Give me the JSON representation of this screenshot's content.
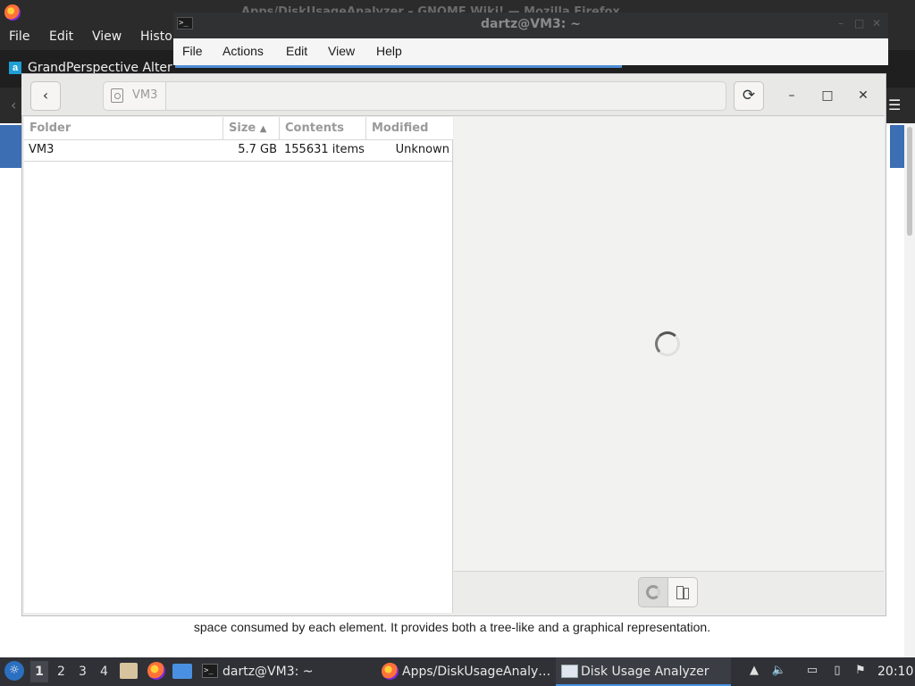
{
  "firefox": {
    "title": "Apps/DiskUsageAnalyzer – GNOME Wiki! — Mozilla Firefox",
    "menu": [
      "File",
      "Edit",
      "View",
      "Histo"
    ],
    "tab_label": "GrandPerspective Altern",
    "tab_icon_letter": "a",
    "page_text": "space consumed by each element. It provides both a tree-like and a graphical representation."
  },
  "terminal": {
    "title": "dartz@VM3: ~",
    "icon_text": ">_",
    "menu": [
      "File",
      "Actions",
      "Edit",
      "View",
      "Help"
    ]
  },
  "dua": {
    "path_label": "VM3",
    "columns": [
      "Folder",
      "Size",
      "Contents",
      "Modified"
    ],
    "sort_indicator": "▲",
    "rows": [
      {
        "folder": "VM3",
        "size": "5.7 GB",
        "contents": "155631 items",
        "modified": "Unknown"
      }
    ],
    "icons": {
      "back": "‹",
      "refresh": "⟳",
      "minimize": "–",
      "maximize": "□",
      "close": "✕"
    }
  },
  "taskbar": {
    "workspaces": [
      "1",
      "2",
      "3",
      "4"
    ],
    "tasks": [
      "dartz@VM3: ~",
      "Apps/DiskUsageAnaly…",
      "Disk Usage Analyzer"
    ],
    "clock": "20:10"
  },
  "colors": {
    "accent": "#4a90e2",
    "taskbar": "#2f3136"
  }
}
